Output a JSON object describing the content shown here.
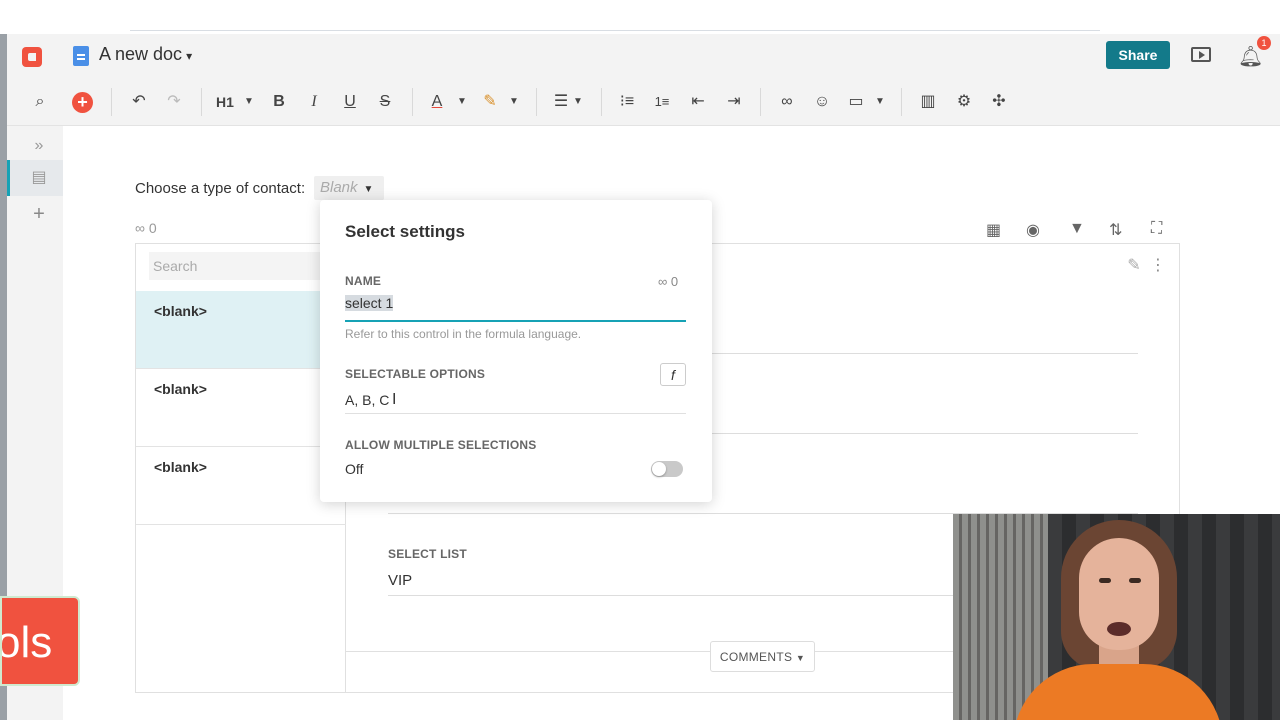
{
  "app": {
    "doc_title": "A new doc",
    "share_label": "Share",
    "notification_count": "1"
  },
  "toolbar": {
    "heading_label": "H1",
    "bold": "B",
    "italic": "I",
    "underline": "U",
    "strike": "S",
    "text_color": "A"
  },
  "page": {
    "choose_label": "Choose a type of contact:",
    "choose_value": "Blank",
    "link_count": "0",
    "search_placeholder": "Search",
    "rows": [
      "<blank>",
      "<blank>",
      "<blank>"
    ],
    "select_list_label": "SELECT LIST",
    "select_list_value": "VIP",
    "comments_label": "COMMENTS"
  },
  "popup": {
    "title": "Select settings",
    "name_label": "NAME",
    "name_link_count": "0",
    "name_value": "select 1",
    "name_hint": "Refer to this control in the formula language.",
    "options_label": "SELECTABLE OPTIONS",
    "options_value": "A, B, C",
    "formula_btn": "f",
    "multi_label": "ALLOW MULTIPLE SELECTIONS",
    "multi_value": "Off"
  },
  "overlay": {
    "tools_text": "ols"
  },
  "colors": {
    "brand": "#f0523f",
    "accent": "#137a8a",
    "focus": "#16a2b5"
  }
}
